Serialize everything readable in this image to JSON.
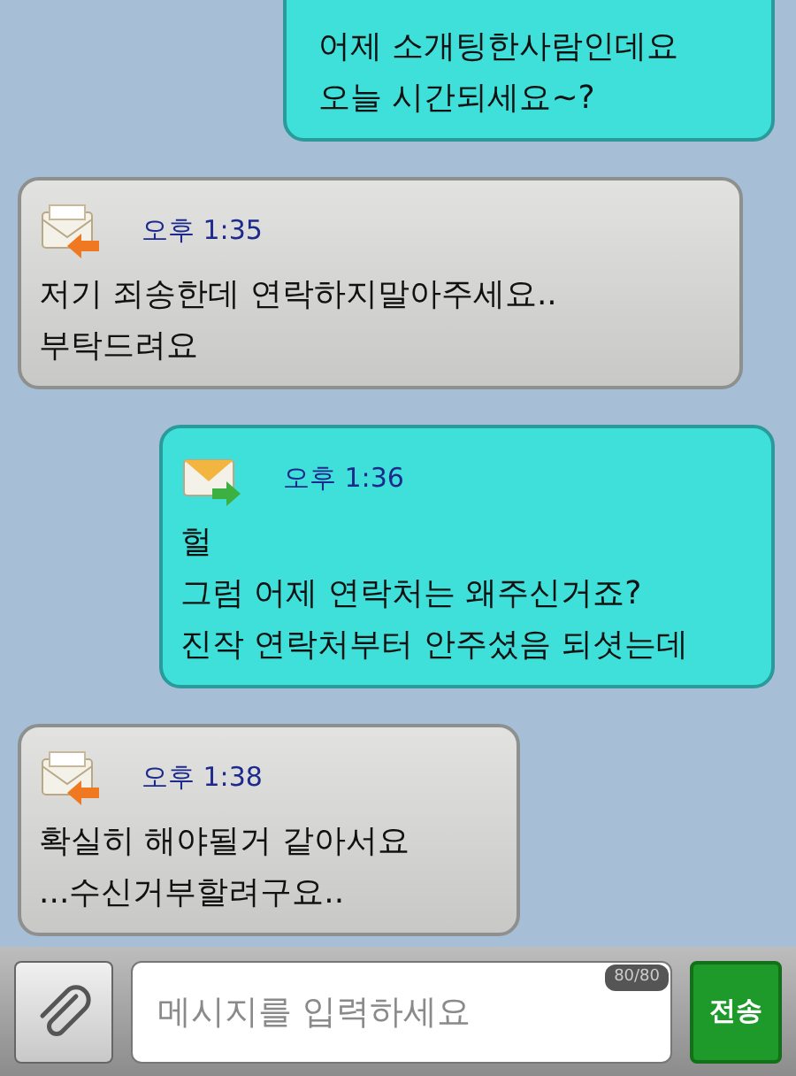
{
  "messages": [
    {
      "kind": "sent",
      "text": "어제 소개팅한사람인데요\n오늘 시간되세요~?"
    },
    {
      "kind": "received",
      "time": "오후 1:35",
      "text": "저기 죄송한데 연락하지말아주세요..\n부탁드려요"
    },
    {
      "kind": "sent",
      "time": "오후 1:36",
      "text": "헐\n그럼 어제 연락처는 왜주신거죠?\n진작 연락처부터 안주셨음 되셧는데"
    },
    {
      "kind": "received",
      "time": "오후 1:38",
      "text": "확실히 해야될거 같아서요\n...수신거부할려구요.."
    }
  ],
  "composer": {
    "placeholder": "메시지를 입력하세요",
    "counter": "80/80",
    "send": "전송"
  }
}
